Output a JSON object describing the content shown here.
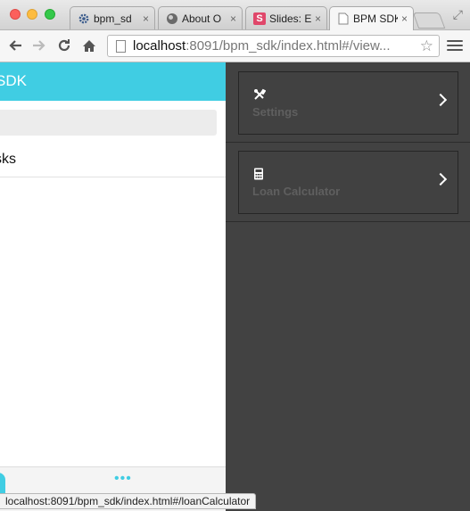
{
  "browser": {
    "tabs": [
      {
        "label": "bpm_sd",
        "icon": "gear-icon"
      },
      {
        "label": "About O",
        "icon": "globe-icon"
      },
      {
        "label": "Slides: E",
        "icon": "slides-icon",
        "icon_text": "S",
        "icon_color": "#e0476a"
      },
      {
        "label": "BPM SDK",
        "icon": "page-icon"
      }
    ],
    "close_glyph": "×",
    "url_host": "localhost",
    "url_rest": ":8091/bpm_sdk/index.html#/view..."
  },
  "app": {
    "header_title": "SDK",
    "list_item_label": "sks",
    "pager_dots": "•••",
    "accent_color": "#40cde3"
  },
  "side_menu": {
    "items": [
      {
        "label": "Settings",
        "icon": "tools-icon"
      },
      {
        "label": "Loan Calculator",
        "icon": "calculator-icon"
      }
    ]
  },
  "status_bar": {
    "text": "localhost:8091/bpm_sdk/index.html#/loanCalculator"
  }
}
